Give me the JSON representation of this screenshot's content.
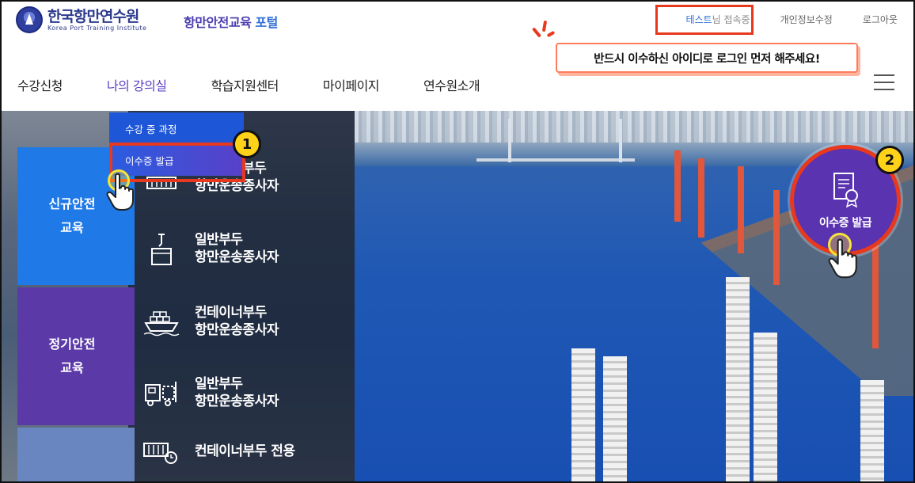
{
  "logo": {
    "name_ko": "한국항만연수원",
    "name_en": "Korea Port Training Institute"
  },
  "portal": {
    "prefix": "항만안전교육",
    "suffix": "포털"
  },
  "top_links": {
    "user_name": "테스트",
    "user_suffix": "님 접속중",
    "edit_profile": "개인정보수정",
    "logout": "로그아웃"
  },
  "callout": {
    "text": "반드시 이수하신 아이디로 로그인 먼저 해주세요!"
  },
  "nav": {
    "items": [
      {
        "label": "수강신청"
      },
      {
        "label": "나의 강의실"
      },
      {
        "label": "학습지원센터"
      },
      {
        "label": "마이페이지"
      },
      {
        "label": "연수원소개"
      }
    ]
  },
  "submenu": {
    "items": [
      {
        "label": "수강 중 과정"
      },
      {
        "label": "이수증 발급"
      }
    ]
  },
  "categories": {
    "new": {
      "line1": "신규안전",
      "line2": "교육"
    },
    "regular": {
      "line1": "정기안전",
      "line2": "교육"
    },
    "advanced": {
      "line1": ""
    }
  },
  "courses": [
    {
      "line1": "부두",
      "line2": "항만운송종사자",
      "icon": "container-stack-icon"
    },
    {
      "line1": "일반부두",
      "line2": "항만운송종사자",
      "icon": "crane-box-icon"
    },
    {
      "line1": "컨테이너부두",
      "line2": "항만운송종사자",
      "icon": "cargo-ship-icon"
    },
    {
      "line1": "일반부두",
      "line2": "항만운송종사자",
      "icon": "forklift-truck-icon"
    },
    {
      "line1": "컨테이너부두 전용",
      "line2": "",
      "icon": "container-gear-icon"
    }
  ],
  "certificate": {
    "label": "이수증 발급"
  },
  "badges": {
    "one": "1",
    "two": "2"
  },
  "colors": {
    "brand_blue": "#1f7ae8",
    "brand_purple": "#5b3aa8",
    "highlight_red": "#e8381d",
    "badge_yellow": "#ffd21a"
  }
}
